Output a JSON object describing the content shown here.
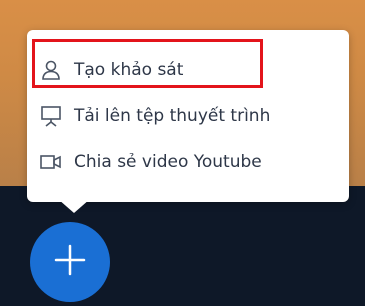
{
  "menu": {
    "items": [
      {
        "label": "Tạo khảo sát",
        "icon": "person-icon"
      },
      {
        "label": "Tải lên tệp thuyết trình",
        "icon": "presentation-board-icon"
      },
      {
        "label": "Chia sẻ video Youtube",
        "icon": "video-camera-icon"
      }
    ]
  },
  "fab": {
    "icon": "plus-icon"
  },
  "colors": {
    "accent": "#1a6fd4",
    "highlight": "#e3141b"
  }
}
